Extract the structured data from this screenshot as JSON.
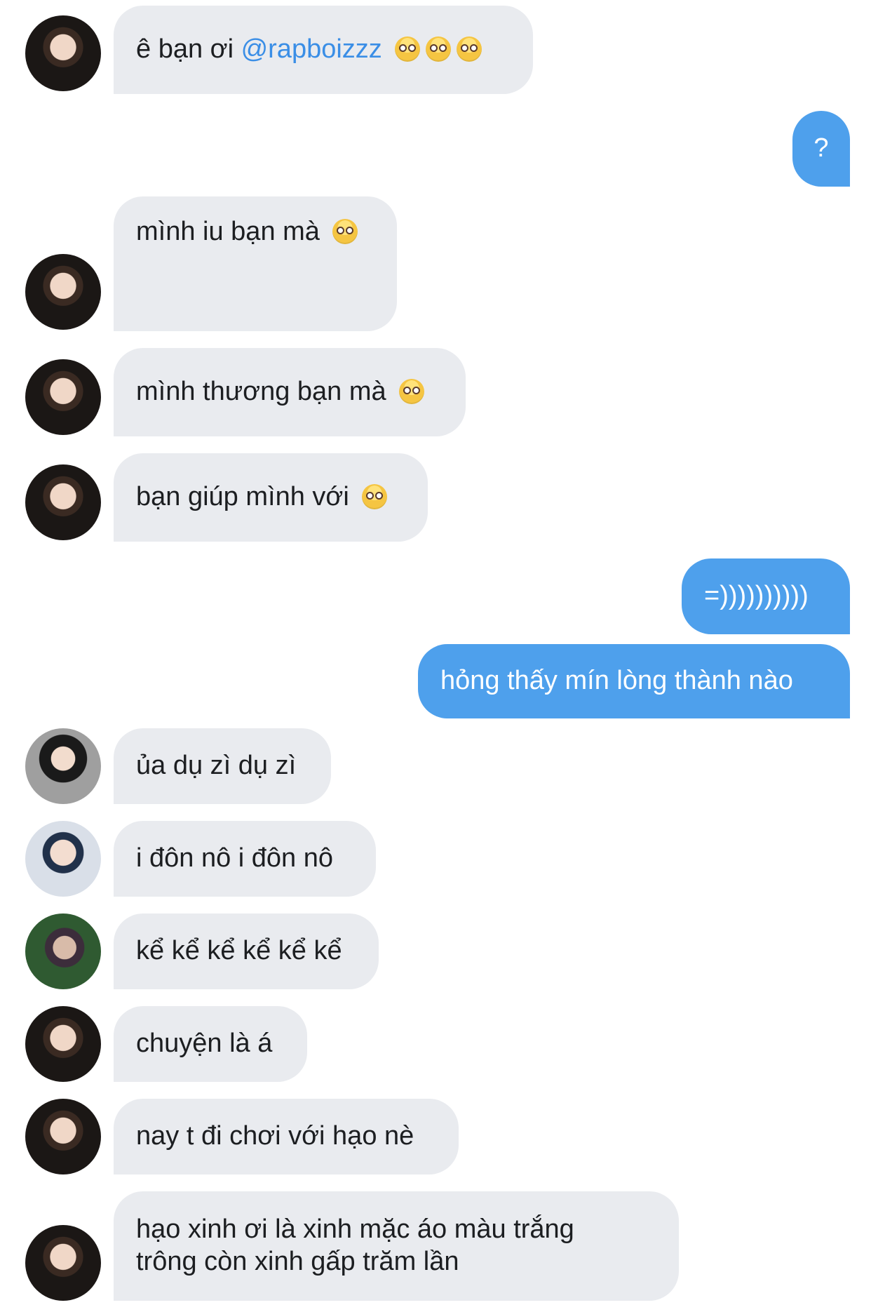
{
  "messages": [
    {
      "side": "in",
      "parts": [
        {
          "t": "ê bạn ơi "
        },
        {
          "t": "@rapboizzz",
          "mention": true
        }
      ],
      "emoji_count": 3,
      "avatar": "main"
    },
    {
      "side": "out",
      "text": "?"
    },
    {
      "side": "in",
      "text": "mình iu bạn mà",
      "emoji_count": 1,
      "avatar": "main"
    },
    {
      "side": "in",
      "text": "mình thương bạn mà",
      "emoji_count": 1,
      "avatar": "main"
    },
    {
      "side": "in",
      "text": "bạn giúp mình với",
      "emoji_count": 1,
      "avatar": "main"
    },
    {
      "side": "out",
      "text": "=))))))))))"
    },
    {
      "side": "out",
      "text": "hỏng thấy mín lòng thành nào"
    },
    {
      "side": "in",
      "text": "ủa dụ zì dụ zì",
      "avatar": "b"
    },
    {
      "side": "in",
      "text": "i đôn nô i đôn nô",
      "avatar": "c"
    },
    {
      "side": "in",
      "text": "kể kể kể kể kể kể",
      "avatar": "d"
    },
    {
      "side": "in",
      "text": "chuyện là á",
      "avatar": "main"
    },
    {
      "side": "in",
      "text": "nay t đi chơi với hạo nè",
      "avatar": "main"
    },
    {
      "side": "in",
      "line1": "hạo xinh ơi là xinh mặc áo màu trắng",
      "line2": "trông còn xinh gấp trăm lần",
      "avatar": "main"
    }
  ],
  "emoji_name": "pleading-face-emoji"
}
